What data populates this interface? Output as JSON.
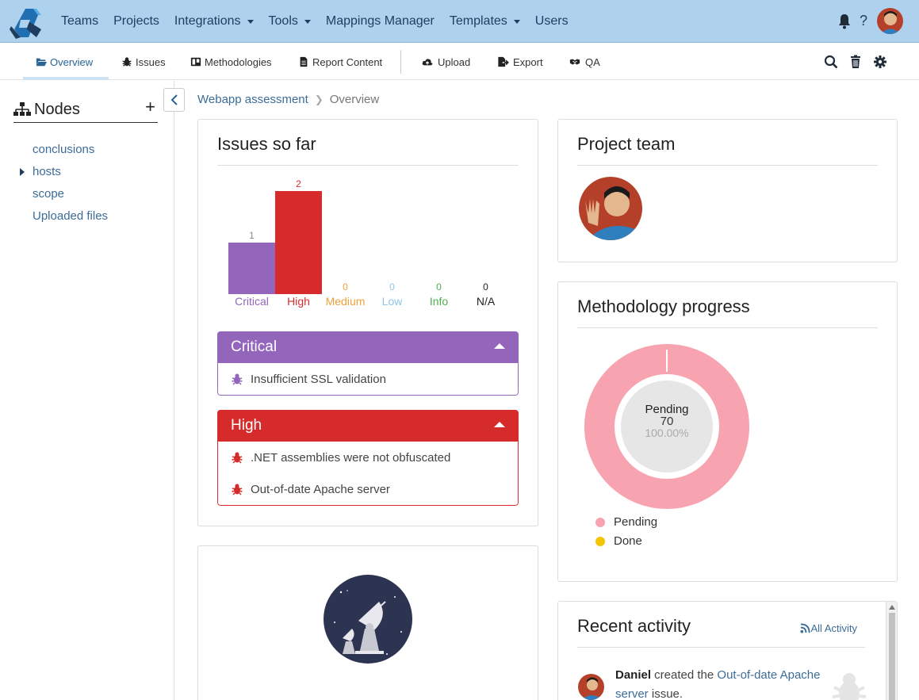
{
  "nav": {
    "items": [
      {
        "label": "Teams",
        "dropdown": false
      },
      {
        "label": "Projects",
        "dropdown": false
      },
      {
        "label": "Integrations",
        "dropdown": true
      },
      {
        "label": "Tools",
        "dropdown": true
      },
      {
        "label": "Mappings Manager",
        "dropdown": false
      },
      {
        "label": "Templates",
        "dropdown": true
      },
      {
        "label": "Users",
        "dropdown": false
      }
    ],
    "help": "?"
  },
  "subnav": {
    "overview": "Overview",
    "issues": "Issues",
    "methodologies": "Methodologies",
    "report_content": "Report Content",
    "upload": "Upload",
    "export": "Export",
    "qa": "QA"
  },
  "sidebar": {
    "title": "Nodes",
    "add": "+",
    "nodes": [
      {
        "label": "conclusions",
        "expandable": false
      },
      {
        "label": "hosts",
        "expandable": true
      },
      {
        "label": "scope",
        "expandable": false
      },
      {
        "label": "Uploaded files",
        "expandable": false
      }
    ]
  },
  "breadcrumb": {
    "project": "Webapp assessment",
    "current": "Overview"
  },
  "issues_card": {
    "title": "Issues so far",
    "groups": [
      {
        "name": "Critical",
        "color": "#9366bc",
        "items": [
          "Insufficient SSL validation"
        ]
      },
      {
        "name": "High",
        "color": "#d62b2b",
        "items": [
          ".NET assemblies were not obfuscated",
          "Out-of-date Apache server"
        ]
      }
    ]
  },
  "chart_data": {
    "type": "bar",
    "title": "",
    "categories": [
      "Critical",
      "High",
      "Medium",
      "Low",
      "Info",
      "N/A"
    ],
    "values": [
      1,
      2,
      0,
      0,
      0,
      0
    ],
    "colors": [
      "#9366bc",
      "#d62b2b",
      "#f0a13a",
      "#8ec6e6",
      "#4caf50",
      "#222222"
    ],
    "ylim": [
      0,
      2
    ]
  },
  "team_card": {
    "title": "Project team"
  },
  "methodology_card": {
    "title": "Methodology progress",
    "center_label": "Pending",
    "center_count": "70",
    "center_percent": "100.00%",
    "legend": [
      {
        "label": "Pending",
        "color": "#f8a3b0"
      },
      {
        "label": "Done",
        "color": "#f5c400"
      }
    ],
    "progress": {
      "pending": 70,
      "done": 0
    }
  },
  "activity_card": {
    "title": "Recent activity",
    "all_link": "All Activity",
    "entry": {
      "user": "Daniel",
      "text_before": " created the ",
      "link": "Out-of-date Apache server",
      "text_after": " issue."
    }
  },
  "colors": {
    "nav_bg": "#aed1ee",
    "link": "#3c6c98"
  }
}
